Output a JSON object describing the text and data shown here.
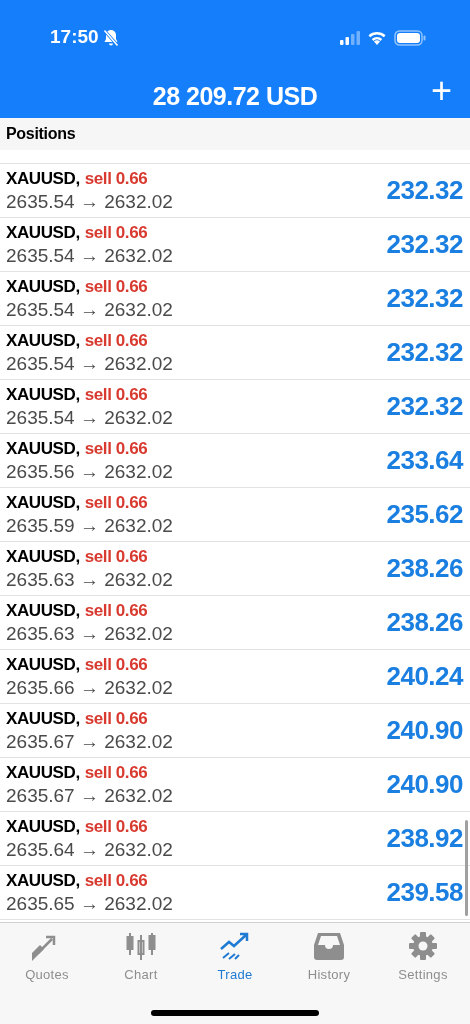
{
  "status_bar": {
    "time": "17:50"
  },
  "header": {
    "balance": "28 209.72 USD",
    "add_button": "+"
  },
  "section_title": "Positions",
  "positions": [
    {
      "symbol": "XAUUSD,",
      "action": "sell 0.66",
      "prices": "2635.54 → 2632.02",
      "profit": "232.32"
    },
    {
      "symbol": "XAUUSD,",
      "action": "sell 0.66",
      "prices": "2635.54 → 2632.02",
      "profit": "232.32"
    },
    {
      "symbol": "XAUUSD,",
      "action": "sell 0.66",
      "prices": "2635.54 → 2632.02",
      "profit": "232.32"
    },
    {
      "symbol": "XAUUSD,",
      "action": "sell 0.66",
      "prices": "2635.54 → 2632.02",
      "profit": "232.32"
    },
    {
      "symbol": "XAUUSD,",
      "action": "sell 0.66",
      "prices": "2635.54 → 2632.02",
      "profit": "232.32"
    },
    {
      "symbol": "XAUUSD,",
      "action": "sell 0.66",
      "prices": "2635.56 → 2632.02",
      "profit": "233.64"
    },
    {
      "symbol": "XAUUSD,",
      "action": "sell 0.66",
      "prices": "2635.59 → 2632.02",
      "profit": "235.62"
    },
    {
      "symbol": "XAUUSD,",
      "action": "sell 0.66",
      "prices": "2635.63 → 2632.02",
      "profit": "238.26"
    },
    {
      "symbol": "XAUUSD,",
      "action": "sell 0.66",
      "prices": "2635.63 → 2632.02",
      "profit": "238.26"
    },
    {
      "symbol": "XAUUSD,",
      "action": "sell 0.66",
      "prices": "2635.66 → 2632.02",
      "profit": "240.24"
    },
    {
      "symbol": "XAUUSD,",
      "action": "sell 0.66",
      "prices": "2635.67 → 2632.02",
      "profit": "240.90"
    },
    {
      "symbol": "XAUUSD,",
      "action": "sell 0.66",
      "prices": "2635.67 → 2632.02",
      "profit": "240.90"
    },
    {
      "symbol": "XAUUSD,",
      "action": "sell 0.66",
      "prices": "2635.64 → 2632.02",
      "profit": "238.92"
    },
    {
      "symbol": "XAUUSD,",
      "action": "sell 0.66",
      "prices": "2635.65 → 2632.02",
      "profit": "239.58"
    }
  ],
  "tabs": [
    {
      "label": "Quotes",
      "selected": false
    },
    {
      "label": "Chart",
      "selected": false
    },
    {
      "label": "Trade",
      "selected": true
    },
    {
      "label": "History",
      "selected": false
    },
    {
      "label": "Settings",
      "selected": false
    }
  ]
}
